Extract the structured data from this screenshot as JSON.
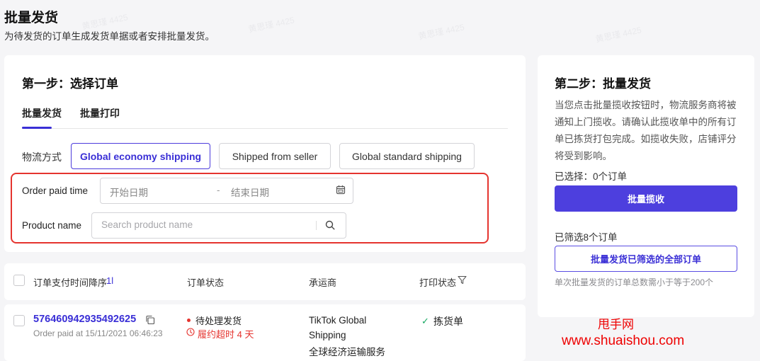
{
  "page": {
    "title": "批量发货",
    "subtitle": "为待发货的订单生成发货单据或者安排批量发货。"
  },
  "step1": {
    "title": "第一步：选择订单",
    "tabs": [
      {
        "label": "批量发货",
        "active": true
      },
      {
        "label": "批量打印",
        "active": false
      }
    ],
    "shipping_label": "物流方式",
    "shipping_options": [
      {
        "label": "Global economy shipping",
        "selected": true
      },
      {
        "label": "Shipped from seller",
        "selected": false
      },
      {
        "label": "Global standard shipping",
        "selected": false
      }
    ],
    "filters": {
      "order_paid_time_label": "Order paid time",
      "start_date_placeholder": "开始日期",
      "date_separator": "-",
      "end_date_placeholder": "结束日期",
      "product_name_label": "Product name",
      "product_search_placeholder": "Search product name"
    }
  },
  "table": {
    "columns": {
      "order_time_sort": "订单支付时间降序",
      "sort_icon": "1l",
      "status": "订单状态",
      "carrier": "承运商",
      "print_status": "打印状态"
    },
    "rows": [
      {
        "order_id": "576460942935492625",
        "order_paid": "Order paid at 15/11/2021 06:46:23",
        "status": "待处理发货",
        "overdue": "履约超时 4 天",
        "carrier_lines": [
          "TikTok Global",
          "Shipping",
          "全球经济运输服务"
        ],
        "print_status": "拣货单"
      }
    ]
  },
  "step2": {
    "title": "第二步：批量发货",
    "description": "当您点击批量揽收按钮时，物流服务商将被通知上门揽收。请确认此揽收单中的所有订单已拣货打包完成。如揽收失败，店铺评分将受到影响。",
    "selected_count": "已选择：0个订单",
    "pickup_button": "批量揽收",
    "filtered_count": "已筛选8个订单",
    "ship_all_button": "批量发货已筛选的全部订单",
    "limit_note": "单次批量发货的订单总数需小于等于200个"
  },
  "watermark": {
    "site_name": "甩手网",
    "site_url": "www.shuaishou.com",
    "user_mark": "黄思瑾 4425"
  },
  "colors": {
    "accent": "#4d3fde",
    "highlight_box": "#e5342f",
    "success": "#17a862"
  }
}
